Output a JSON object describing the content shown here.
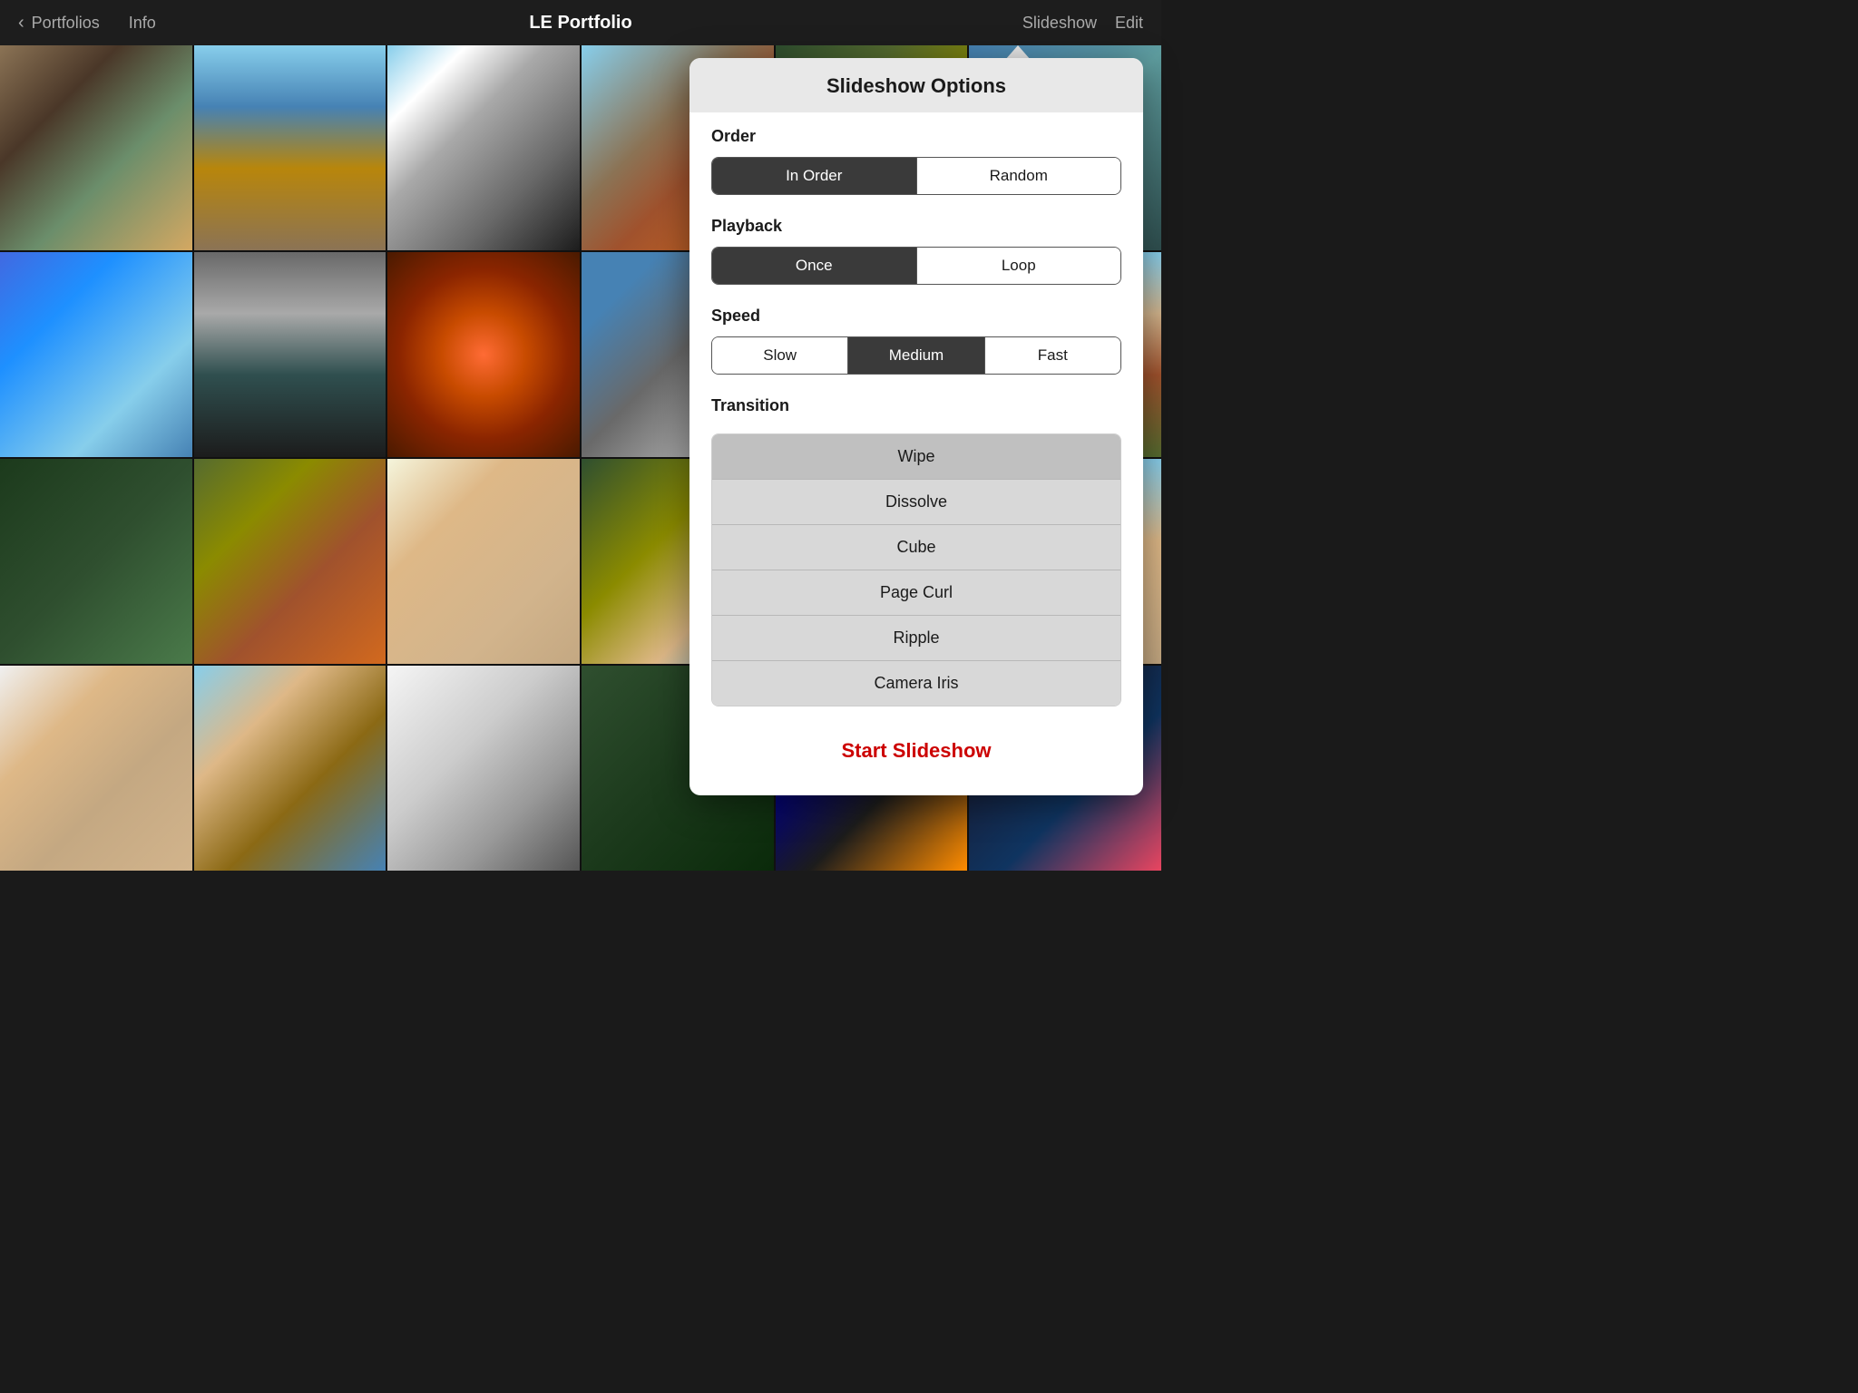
{
  "nav": {
    "back_icon": "‹",
    "back_label": "Portfolios",
    "info_label": "Info",
    "title": "LE Portfolio",
    "slideshow_label": "Slideshow",
    "edit_label": "Edit"
  },
  "popup": {
    "title": "Slideshow Options",
    "order": {
      "label": "Order",
      "options": [
        "In Order",
        "Random"
      ],
      "active": 0
    },
    "playback": {
      "label": "Playback",
      "options": [
        "Once",
        "Loop"
      ],
      "active": 0
    },
    "speed": {
      "label": "Speed",
      "options": [
        "Slow",
        "Medium",
        "Fast"
      ],
      "active": 1
    },
    "transition": {
      "label": "Transition",
      "items": [
        "Wipe",
        "Dissolve",
        "Cube",
        "Page Curl",
        "Ripple",
        "Camera Iris"
      ],
      "selected": 0
    },
    "start_button_label": "Start Slideshow"
  },
  "photos": {
    "grid_cols": 6,
    "grid_rows": 4
  }
}
